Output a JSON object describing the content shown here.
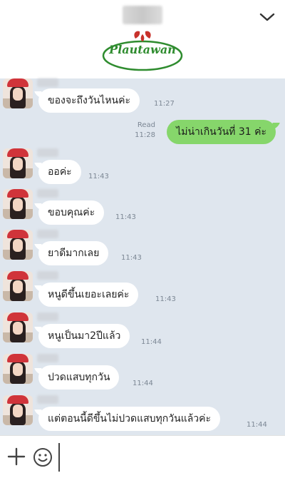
{
  "header": {
    "logo_text": "Plautawan",
    "brand_color": "#2f8c2f",
    "logo_leaf_color": "#c8322c",
    "collapse_icon": "chevron-down-icon"
  },
  "messages": [
    {
      "direction": "in",
      "text": "ของจะถึงวันไหนค่ะ",
      "time": "11:27"
    },
    {
      "direction": "out",
      "text": "ไม่น่าเกินวันที่ 31 ค่ะ",
      "time": "11:28",
      "status": "Read"
    },
    {
      "direction": "in",
      "text": "ออค่ะ",
      "time": "11:43"
    },
    {
      "direction": "in",
      "text": "ขอบคุณค่ะ",
      "time": "11:43"
    },
    {
      "direction": "in",
      "text": "ยาดีมากเลย",
      "time": "11:43"
    },
    {
      "direction": "in",
      "text": "หนูดีขึ้นเยอะเลยค่ะ",
      "time": "11:43"
    },
    {
      "direction": "in",
      "text": "หนูเป็นมา2ปีแล้ว",
      "time": "11:44"
    },
    {
      "direction": "in",
      "text": "ปวดแสบทุกวัน",
      "time": "11:44"
    },
    {
      "direction": "in",
      "text": "แต่ตอนนี้ดีขึ้นไม่ปวดแสบทุกวันแล้วค่ะ",
      "time": "11:44"
    }
  ],
  "colors": {
    "chat_background": "#dfe6ee",
    "outgoing_bubble": "#86d66b",
    "incoming_bubble": "#ffffff"
  },
  "input": {
    "value": "",
    "placeholder": ""
  }
}
